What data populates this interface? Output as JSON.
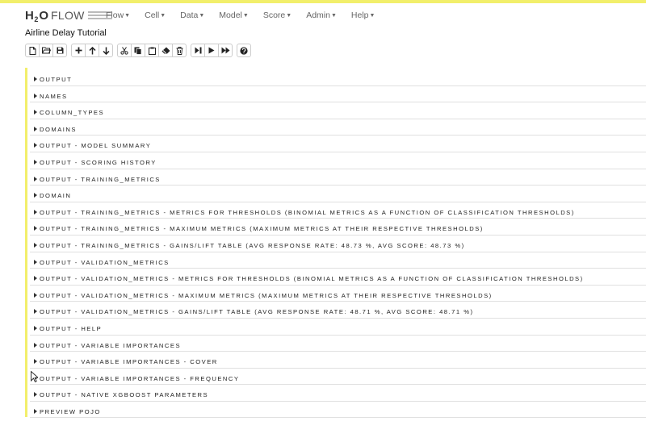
{
  "logo": {
    "h": "H",
    "two": "2",
    "o": "O",
    "flow": "FLOW"
  },
  "menus": [
    {
      "label": "Flow"
    },
    {
      "label": "Cell"
    },
    {
      "label": "Data"
    },
    {
      "label": "Model"
    },
    {
      "label": "Score"
    },
    {
      "label": "Admin"
    },
    {
      "label": "Help"
    }
  ],
  "notebook_title": "Airline Delay Tutorial",
  "toolbar_icons": [
    "new-file-icon",
    "open-folder-icon",
    "save-icon",
    "plus-icon",
    "arrow-up-icon",
    "arrow-down-icon",
    "cut-icon",
    "copy-icon",
    "paste-icon",
    "eraser-icon",
    "trash-icon",
    "step-forward-icon",
    "play-icon",
    "fast-forward-icon",
    "help-icon"
  ],
  "outputs": [
    "OUTPUT",
    "NAMES",
    "COLUMN_TYPES",
    "DOMAINS",
    "OUTPUT - MODEL SUMMARY",
    "OUTPUT - SCORING HISTORY",
    "OUTPUT - TRAINING_METRICS",
    "DOMAIN",
    "OUTPUT - TRAINING_METRICS - METRICS FOR THRESHOLDS (BINOMIAL METRICS AS A FUNCTION OF CLASSIFICATION THRESHOLDS)",
    "OUTPUT - TRAINING_METRICS - MAXIMUM METRICS (MAXIMUM METRICS AT THEIR RESPECTIVE THRESHOLDS)",
    "OUTPUT - TRAINING_METRICS - GAINS/LIFT TABLE (AVG RESPONSE RATE: 48.73 %, AVG SCORE: 48.73 %)",
    "OUTPUT - VALIDATION_METRICS",
    "OUTPUT - VALIDATION_METRICS - METRICS FOR THRESHOLDS (BINOMIAL METRICS AS A FUNCTION OF CLASSIFICATION THRESHOLDS)",
    "OUTPUT - VALIDATION_METRICS - MAXIMUM METRICS (MAXIMUM METRICS AT THEIR RESPECTIVE THRESHOLDS)",
    "OUTPUT - VALIDATION_METRICS - GAINS/LIFT TABLE (AVG RESPONSE RATE: 48.71 %, AVG SCORE: 48.71 %)",
    "OUTPUT - HELP",
    "OUTPUT - VARIABLE IMPORTANCES",
    "OUTPUT - VARIABLE IMPORTANCES - COVER",
    "OUTPUT - VARIABLE IMPORTANCES - FREQUENCY",
    "OUTPUT - NATIVE XGBOOST PARAMETERS",
    "PREVIEW POJO"
  ],
  "colors": {
    "accent": "#f2ef6b",
    "rule": "#e0e0e0"
  }
}
